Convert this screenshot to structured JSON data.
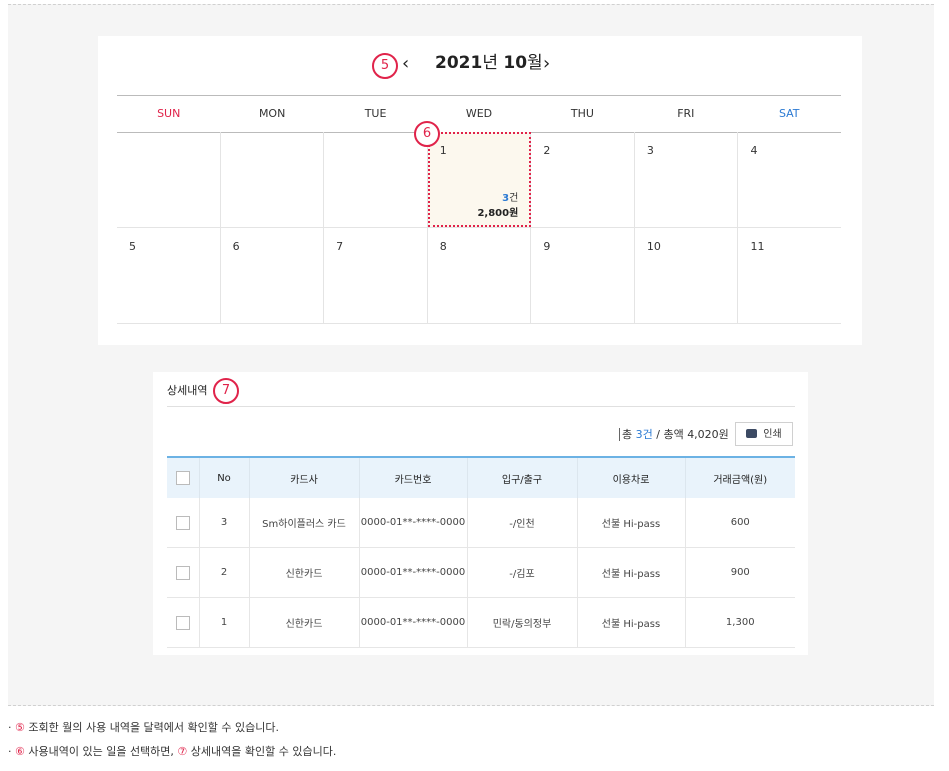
{
  "calendar": {
    "marker_nav": "5",
    "marker_day": "6",
    "prev_icon": "‹",
    "next_icon": "›",
    "year": "2021",
    "year_suffix": "년",
    "month": "10",
    "month_suffix": "월",
    "weekdays": [
      "SUN",
      "MON",
      "TUE",
      "WED",
      "THU",
      "FRI",
      "SAT"
    ],
    "week1": [
      "",
      "",
      "",
      "1",
      "2",
      "3",
      "4"
    ],
    "week2": [
      "5",
      "6",
      "7",
      "8",
      "9",
      "10",
      "11"
    ],
    "selected": {
      "count_num": "3",
      "count_unit": "건",
      "amount": "2,800원"
    }
  },
  "detail": {
    "title": "상세내역",
    "marker": "7",
    "summary": {
      "prefix": "총 ",
      "count": "3건",
      "mid": " / 총액 ",
      "total": "4,020원"
    },
    "print_label": "인쇄",
    "headers": [
      "No",
      "카드사",
      "카드번호",
      "입구/출구",
      "이용차로",
      "거래금액(원)"
    ],
    "rows": [
      {
        "no": "3",
        "card": "Sm하이플러스 카드",
        "number": "0000-01**-****-0000",
        "gate": "-/인천",
        "lane": "선불 Hi-pass",
        "amount": "600"
      },
      {
        "no": "2",
        "card": "신한카드",
        "number": "0000-01**-****-0000",
        "gate": "-/김포",
        "lane": "선불 Hi-pass",
        "amount": "900"
      },
      {
        "no": "1",
        "card": "신한카드",
        "number": "0000-01**-****-0000",
        "gate": "민락/동의정부",
        "lane": "선불 Hi-pass",
        "amount": "1,300"
      }
    ]
  },
  "notes": {
    "bullet": "·",
    "n1_marker": "⑤",
    "n1_text": " 조회한 월의 사용 내역을 달력에서 확인할 수 있습니다.",
    "n2_marker1": "⑥",
    "n2_text1": " 사용내역이 있는 일을 선택하면, ",
    "n2_marker2": "⑦",
    "n2_text2": " 상세내역을 확인할 수 있습니다."
  }
}
